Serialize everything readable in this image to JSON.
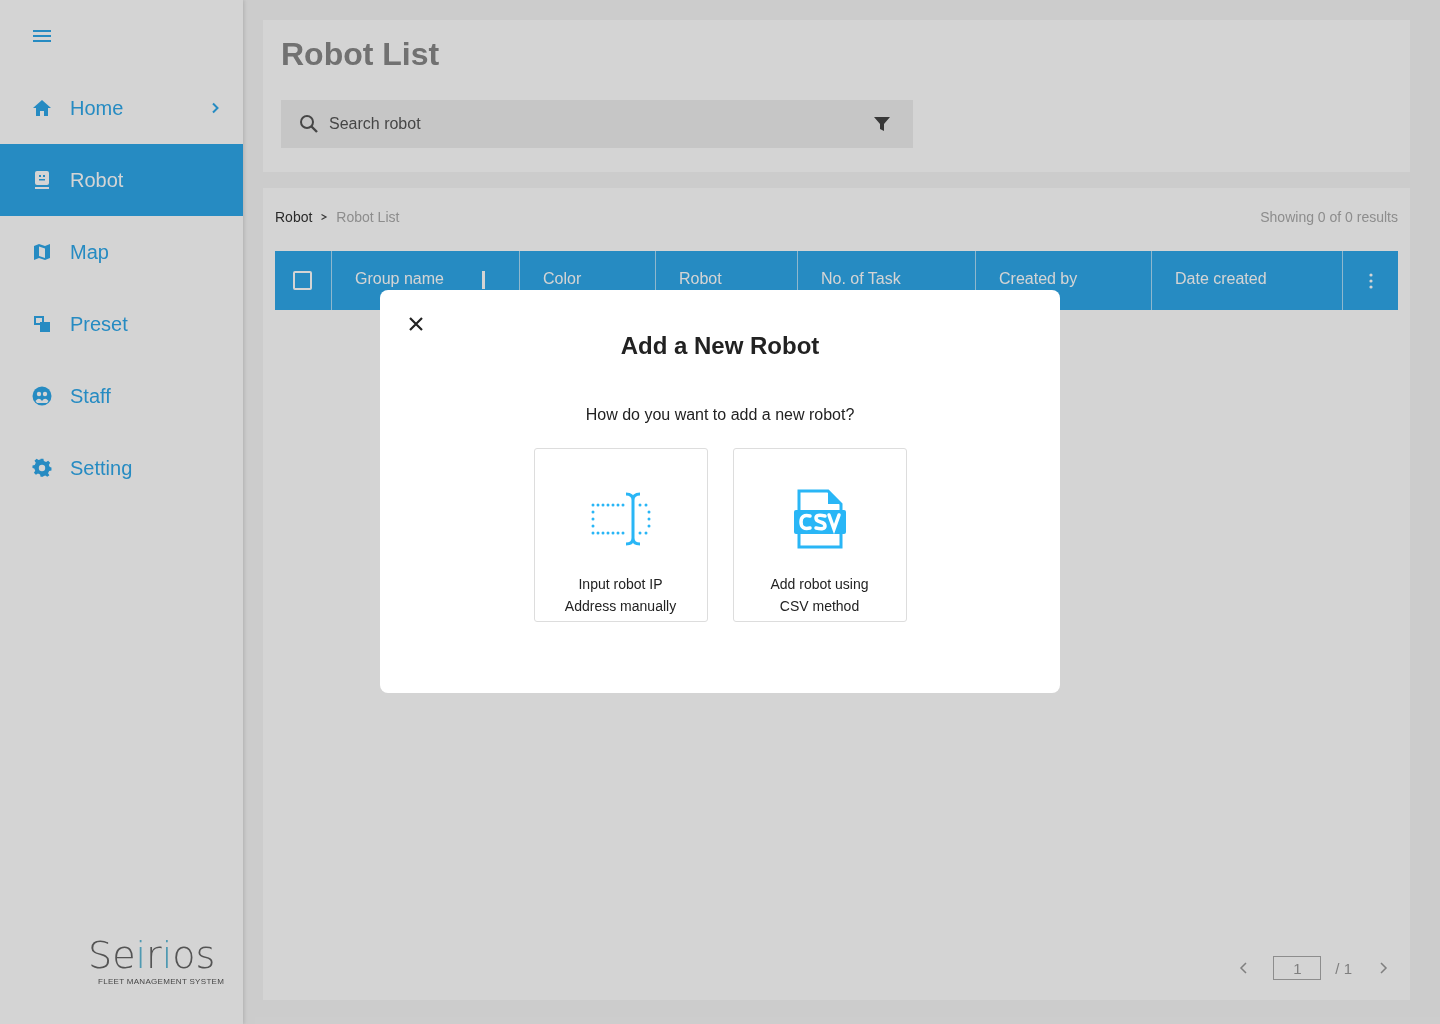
{
  "sidebar": {
    "items": [
      {
        "label": "Home",
        "selected": false,
        "expandable": true
      },
      {
        "label": "Robot",
        "selected": true,
        "expandable": false
      },
      {
        "label": "Map",
        "selected": false,
        "expandable": false
      },
      {
        "label": "Preset",
        "selected": false,
        "expandable": false
      },
      {
        "label": "Staff",
        "selected": false,
        "expandable": false
      },
      {
        "label": "Setting",
        "selected": false,
        "expandable": false
      }
    ],
    "logo": {
      "name": "Seirios",
      "tagline": "FLEET MANAGEMENT SYSTEM"
    }
  },
  "header": {
    "title": "Robot List",
    "search": {
      "placeholder": "Search robot"
    }
  },
  "breadcrumb": [
    {
      "label": "Robot",
      "current": false
    },
    {
      "label": "Robot List",
      "current": true
    }
  ],
  "results": "Showing 0 of 0 results",
  "table": {
    "select_all": {
      "checked": false
    },
    "columns": [
      "Group name",
      "Color",
      "Robot",
      "No. of Task",
      "Created by",
      "Date created"
    ]
  },
  "pagination": {
    "page": "1",
    "total": "/ 1"
  },
  "dialog": {
    "title": "Add a New Robot",
    "question": "How do you want to add a new robot?",
    "options": [
      {
        "label": "Input robot IP Address manually"
      },
      {
        "label": "Add robot using CSV method"
      }
    ]
  }
}
